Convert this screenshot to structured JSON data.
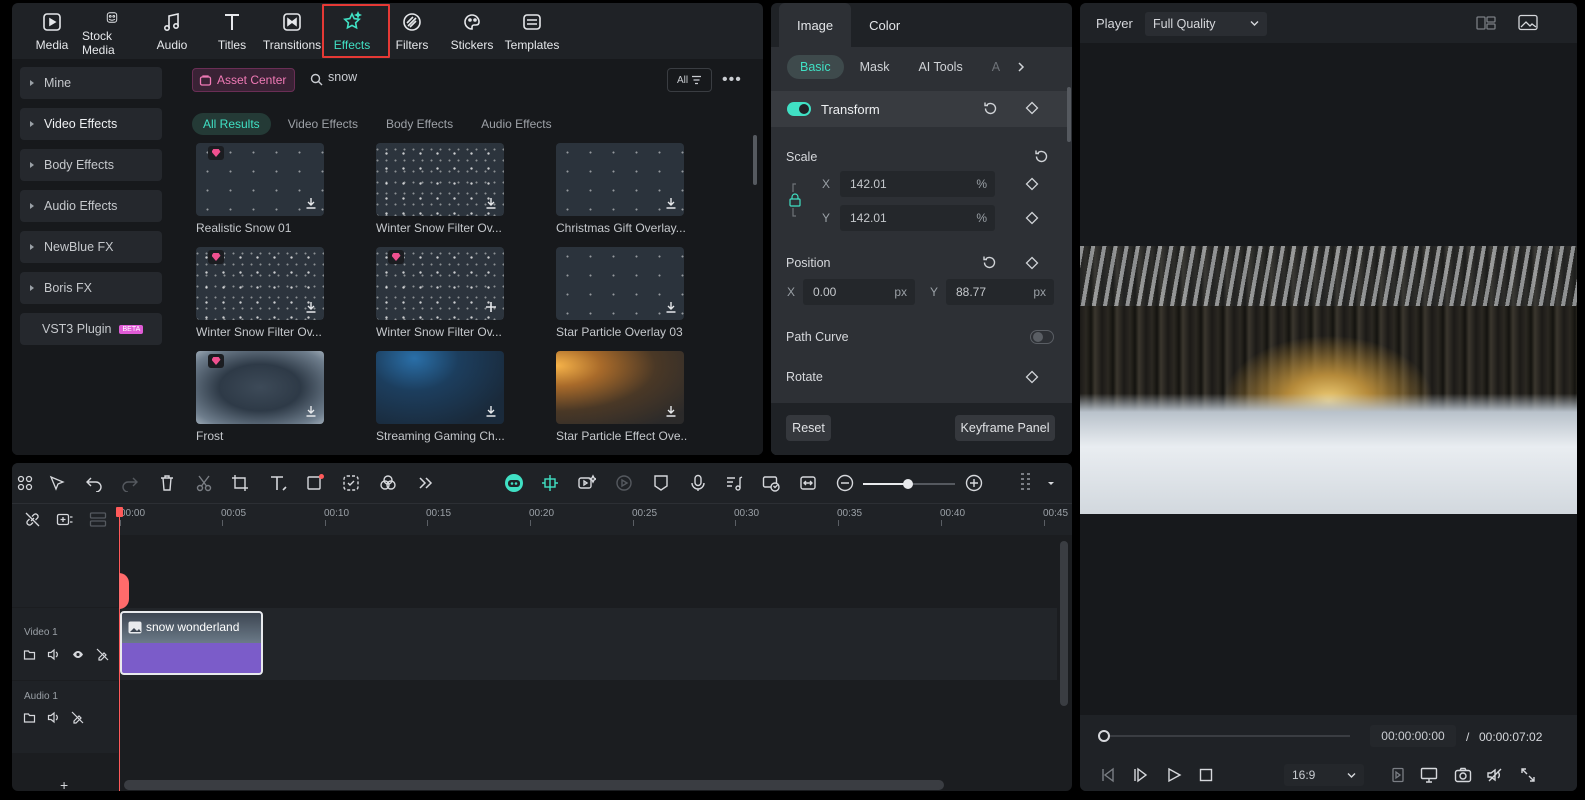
{
  "toolbar": {
    "items": [
      {
        "label": "Media",
        "icon": "media-icon"
      },
      {
        "label": "Stock Media",
        "icon": "stock-media-icon"
      },
      {
        "label": "Audio",
        "icon": "audio-icon"
      },
      {
        "label": "Titles",
        "icon": "titles-icon"
      },
      {
        "label": "Transitions",
        "icon": "transitions-icon"
      },
      {
        "label": "Effects",
        "icon": "effects-icon",
        "active": true
      },
      {
        "label": "Filters",
        "icon": "filters-icon"
      },
      {
        "label": "Stickers",
        "icon": "stickers-icon"
      },
      {
        "label": "Templates",
        "icon": "templates-icon"
      }
    ]
  },
  "sidebar": {
    "items": [
      {
        "label": "Mine"
      },
      {
        "label": "Video Effects"
      },
      {
        "label": "Body Effects"
      },
      {
        "label": "Audio Effects"
      },
      {
        "label": "NewBlue FX"
      },
      {
        "label": "Boris FX"
      },
      {
        "label": "VST3 Plugin",
        "badge": "BETA"
      }
    ]
  },
  "search": {
    "asset_center": "Asset Center",
    "value": "snow",
    "filter_label": "All"
  },
  "categories": [
    "All Results",
    "Video Effects",
    "Body Effects",
    "Audio Effects"
  ],
  "results": [
    {
      "title": "Realistic Snow 01",
      "premium": true,
      "action": "download"
    },
    {
      "title": "Winter Snow Filter Ov...",
      "premium": false,
      "action": "download"
    },
    {
      "title": "Christmas Gift Overlay...",
      "premium": false,
      "action": "download"
    },
    {
      "title": "Winter Snow Filter Ov...",
      "premium": true,
      "action": "download"
    },
    {
      "title": "Winter Snow Filter Ov...",
      "premium": true,
      "action": "add"
    },
    {
      "title": "Star Particle Overlay 03",
      "premium": false,
      "action": "download"
    },
    {
      "title": "Frost",
      "premium": true,
      "action": "download"
    },
    {
      "title": "Streaming Gaming Ch...",
      "premium": false,
      "action": "download"
    },
    {
      "title": "Star Particle Effect Ove...",
      "premium": false,
      "action": "download"
    }
  ],
  "props": {
    "tabs": [
      "Image",
      "Color"
    ],
    "subtabs": [
      "Basic",
      "Mask",
      "AI Tools",
      "A"
    ],
    "transform_label": "Transform",
    "scale_label": "Scale",
    "scale_x": "142.01",
    "scale_y": "142.01",
    "percent": "%",
    "position_label": "Position",
    "pos_x": "0.00",
    "pos_y": "88.77",
    "px": "px",
    "x": "X",
    "y": "Y",
    "path_curve_label": "Path Curve",
    "rotate_label": "Rotate",
    "reset": "Reset",
    "keyframe_panel": "Keyframe Panel"
  },
  "player": {
    "label": "Player",
    "quality": "Full Quality",
    "current_time": "00:00:00:00",
    "separator": "/",
    "total_time": "00:00:07:02",
    "ratio": "16:9"
  },
  "timeline": {
    "ticks": [
      "00:00",
      "00:05",
      "00:10",
      "00:15",
      "00:20",
      "00:25",
      "00:30",
      "00:35",
      "00:40",
      "00:45"
    ],
    "video_track": "Video 1",
    "audio_track": "Audio 1",
    "clip_name": "snow wonderland"
  },
  "colors": {
    "accent": "#40e0c4",
    "highlight_box": "#e53935",
    "playhead": "#ff5a5a",
    "clip": "#7b5cc9"
  }
}
